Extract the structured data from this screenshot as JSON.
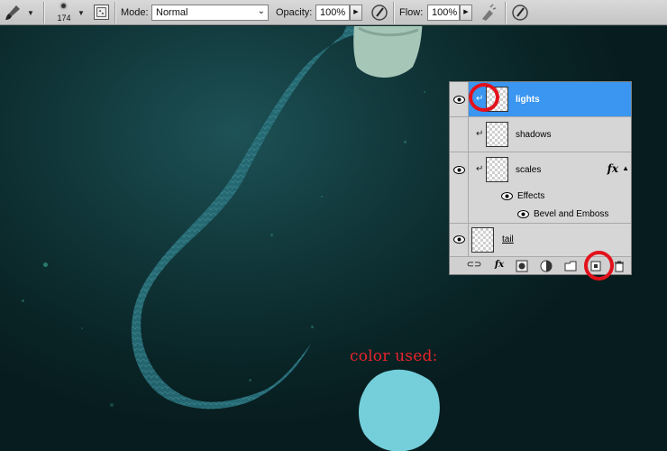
{
  "optionsbar": {
    "brush_size": "174",
    "mode_label": "Mode:",
    "mode_value": "Normal",
    "opacity_label": "Opacity:",
    "opacity_value": "100%",
    "flow_label": "Flow:",
    "flow_value": "100%"
  },
  "canvas": {
    "annotation": "color used:",
    "swatch_color": "#74cfdb"
  },
  "layers": [
    {
      "name": "lights",
      "selected": true
    },
    {
      "name": "shadows"
    },
    {
      "name": "scales",
      "fx": "fx"
    },
    {
      "name": "Effects"
    },
    {
      "name": "Bevel and Emboss"
    },
    {
      "name": "tail"
    }
  ],
  "colors": {
    "highlight": "#3a96f0",
    "annotation_red": "#e3111b"
  }
}
